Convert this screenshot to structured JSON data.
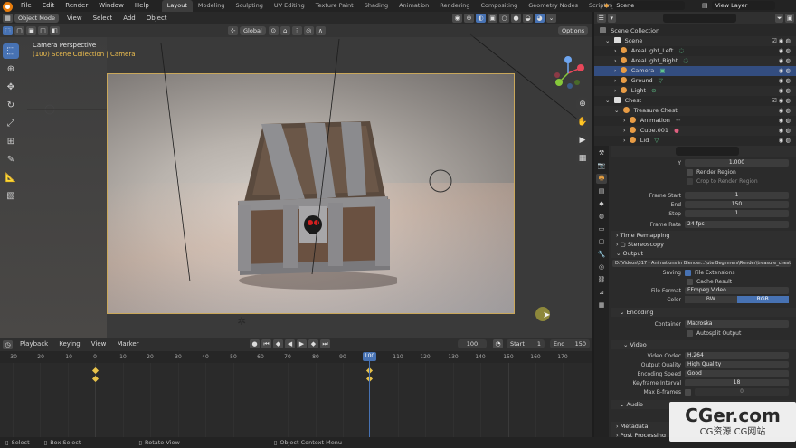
{
  "menubar": {
    "items": [
      "File",
      "Edit",
      "Render",
      "Window",
      "Help"
    ],
    "workspaces": [
      "Layout",
      "Modeling",
      "Sculpting",
      "UV Editing",
      "Texture Paint",
      "Shading",
      "Animation",
      "Rendering",
      "Compositing",
      "Geometry Nodes",
      "Scripting"
    ],
    "active_workspace": "Layout",
    "scene": "Scene",
    "view_layer": "View Layer"
  },
  "viewport": {
    "mode": "Object Mode",
    "menus": [
      "View",
      "Select",
      "Add",
      "Object"
    ],
    "transform_orientation": "Global",
    "options_label": "Options",
    "info_line1": "Camera Perspective",
    "info_line2": "(100) Scene Collection | Camera"
  },
  "outliner": {
    "search_placeholder": "",
    "rows": [
      {
        "label": "Scene Collection",
        "indent": 0
      },
      {
        "label": "Scene",
        "indent": 1
      },
      {
        "label": "AreaLight_Left",
        "indent": 2
      },
      {
        "label": "AreaLight_Right",
        "indent": 2
      },
      {
        "label": "Camera",
        "indent": 2
      },
      {
        "label": "Ground",
        "indent": 2
      },
      {
        "label": "Light",
        "indent": 2
      },
      {
        "label": "Chest",
        "indent": 1
      },
      {
        "label": "Treasure Chest",
        "indent": 2
      },
      {
        "label": "Animation",
        "indent": 3
      },
      {
        "label": "Cube.001",
        "indent": 3
      },
      {
        "label": "Lid",
        "indent": 3
      }
    ]
  },
  "properties": {
    "y_label": "Y",
    "y_value": "1.000",
    "render_region": "Render Region",
    "crop_region": "Crop to Render Region",
    "frame_start_label": "Frame Start",
    "frame_start": "1",
    "end_label": "End",
    "end": "150",
    "step_label": "Step",
    "step": "1",
    "frame_rate_label": "Frame Rate",
    "frame_rate": "24 fps",
    "time_remapping": "Time Remapping",
    "stereoscopy": "Stereoscopy",
    "output_section": "Output",
    "output_path": "D:\\Videos\\317 - Animations in Blender...\\ute Beginners\\Render\\treasure_chest",
    "saving_label": "Saving",
    "file_extensions": "File Extensions",
    "cache_result": "Cache Result",
    "file_format_label": "File Format",
    "file_format": "FFmpeg Video",
    "color_label": "Color",
    "color_bw": "BW",
    "color_rgb": "RGB",
    "encoding_section": "Encoding",
    "container_label": "Container",
    "container": "Matroska",
    "autosplit": "Autosplit Output",
    "video_section": "Video",
    "video_codec_label": "Video Codec",
    "video_codec": "H.264",
    "output_quality_label": "Output Quality",
    "output_quality": "High Quality",
    "encoding_speed_label": "Encoding Speed",
    "encoding_speed": "Good",
    "keyframe_interval_label": "Keyframe Interval",
    "keyframe_interval": "18",
    "max_bframes_label": "Max B-frames",
    "max_bframes": "0",
    "audio_section": "Audio",
    "metadata_section": "Metadata",
    "post_processing_section": "Post Processing"
  },
  "timeline": {
    "menus": [
      "Playback",
      "Keying",
      "View",
      "Marker"
    ],
    "current_frame": "100",
    "start_label": "Start",
    "start": "1",
    "end_label": "End",
    "end": "150",
    "ticks": [
      "-30",
      "-20",
      "-10",
      "0",
      "10",
      "20",
      "30",
      "40",
      "50",
      "60",
      "70",
      "80",
      "90",
      "100",
      "110",
      "120",
      "130",
      "140",
      "150",
      "160",
      "170"
    ]
  },
  "statusbar": {
    "items": [
      "Select",
      "Box Select",
      "Rotate View",
      "Object Context Menu"
    ]
  },
  "watermark": {
    "main": "CGer.com",
    "sub": "CG资源 CG网站"
  },
  "colors": {
    "accent": "#4772b3",
    "camera_frame": "#c9a75a",
    "keyframe": "#e8c24a"
  }
}
